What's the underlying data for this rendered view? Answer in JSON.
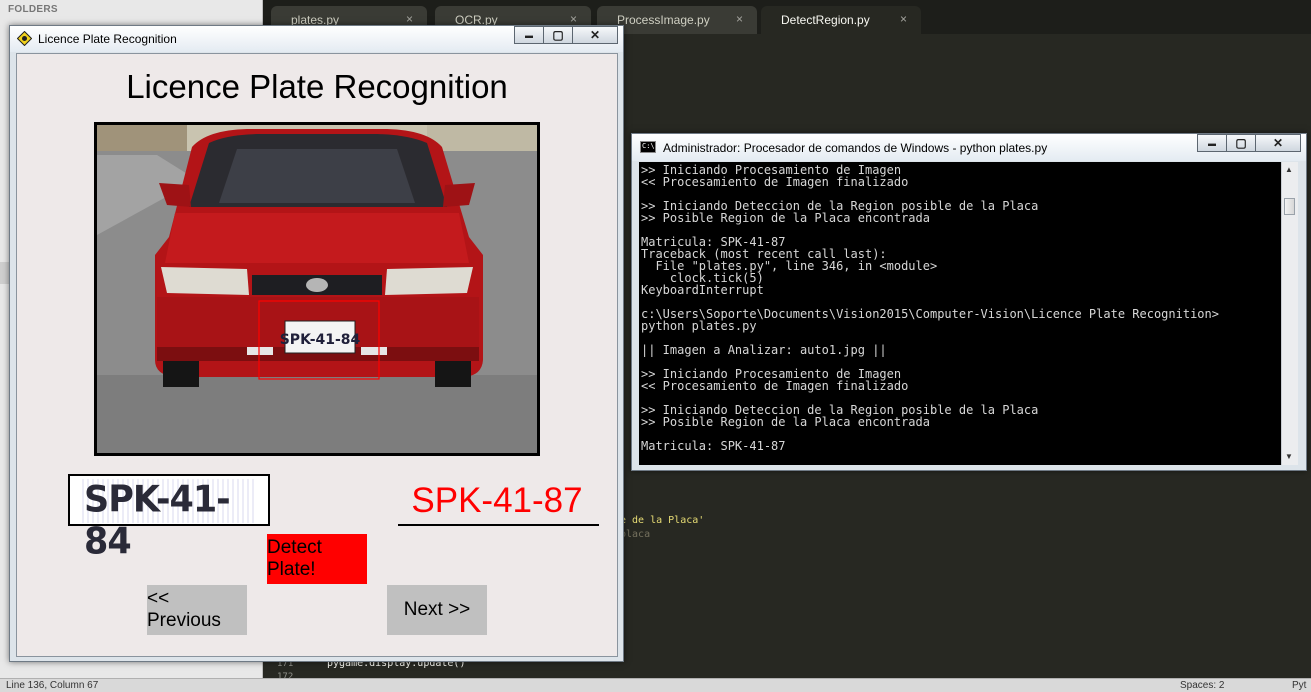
{
  "sidebar": {
    "header": "FOLDERS"
  },
  "editor": {
    "tabs": [
      {
        "label": "plates.py",
        "close": "×"
      },
      {
        "label": "OCR.py",
        "close": "×"
      },
      {
        "label": "ProcessImage.py",
        "close": "×"
      },
      {
        "label": "DetectRegion.py",
        "close": "×"
      }
    ],
    "code_fragments": {
      "frag1": "e de la Placa'",
      "frag2": "placa",
      "frag3": "pygame.display.update()"
    },
    "line_numbers": [
      "171",
      "172"
    ]
  },
  "statusbar": {
    "position": "Line 136, Column 67",
    "spaces": "Spaces: 2",
    "syntax": "Pyt"
  },
  "app_window": {
    "title": "Licence Plate Recognition",
    "heading": "Licence Plate Recognition",
    "plate_crop_text": "SPK-41-84",
    "photo_plate_text": "SPK-41-84",
    "recognized_text": "SPK-41-87",
    "detect_button": "Detect Plate!",
    "previous_button": "<< Previous",
    "next_button": "Next >>",
    "controls": {
      "minimize": "▬",
      "maximize": "▢",
      "close": "✕"
    }
  },
  "console_window": {
    "title": "Administrador: Procesador de comandos de Windows - python  plates.py",
    "icon_label": "C:\\",
    "controls": {
      "minimize": "▬",
      "maximize": "▢",
      "close": "✕"
    },
    "scroll_up": "▲",
    "scroll_down": "▼",
    "output": ">> Iniciando Procesamiento de Imagen\n<< Procesamiento de Imagen finalizado\n\n>> Iniciando Deteccion de la Region posible de la Placa\n>> Posible Region de la Placa encontrada\n\nMatricula: SPK-41-87\nTraceback (most recent call last):\n  File \"plates.py\", line 346, in <module>\n    clock.tick(5)\nKeyboardInterrupt\n\nc:\\Users\\Soporte\\Documents\\Vision2015\\Computer-Vision\\Licence Plate Recognition>\npython plates.py\n\n|| Imagen a Analizar: auto1.jpg ||\n\n>> Iniciando Procesamiento de Imagen\n<< Procesamiento de Imagen finalizado\n\n>> Iniciando Deteccion de la Region posible de la Placa\n>> Posible Region de la Placa encontrada\n\nMatricula: SPK-41-87"
  },
  "colors": {
    "editor_bg": "#272822",
    "recognized_text": "#ff0000",
    "detect_button_bg": "#ff0000",
    "nav_button_bg": "#c0c0c0",
    "console_bg": "#000000",
    "detection_box": "#ff0000"
  }
}
